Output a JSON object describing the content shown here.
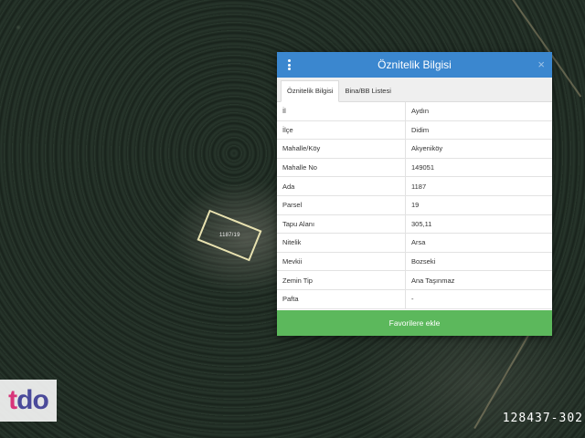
{
  "map": {
    "parcel_label": "1187/19",
    "listing_id": "128437-302"
  },
  "logo": {
    "t": "t",
    "d": "d",
    "o": "o"
  },
  "panel": {
    "title": "Öznitelik Bilgisi",
    "close_glyph": "×",
    "tabs": [
      {
        "label": "Öznitelik Bilgisi",
        "active": true
      },
      {
        "label": "Bina/BB Listesi",
        "active": false
      }
    ],
    "rows": [
      {
        "key": "İl",
        "value": "Aydın"
      },
      {
        "key": "İlçe",
        "value": "Didim"
      },
      {
        "key": "Mahalle/Köy",
        "value": "Akyeniköy"
      },
      {
        "key": "Mahalle No",
        "value": "149051"
      },
      {
        "key": "Ada",
        "value": "1187"
      },
      {
        "key": "Parsel",
        "value": "19"
      },
      {
        "key": "Tapu Alanı",
        "value": "305,11"
      },
      {
        "key": "Nitelik",
        "value": "Arsa"
      },
      {
        "key": "Mevkii",
        "value": "Bozseki"
      },
      {
        "key": "Zemin Tip",
        "value": "Ana Taşınmaz"
      },
      {
        "key": "Pafta",
        "value": "-"
      }
    ],
    "favorite_button_label": "Favorilere ekle",
    "colors": {
      "header": "#3b87cf",
      "button": "#5cb85c"
    }
  }
}
